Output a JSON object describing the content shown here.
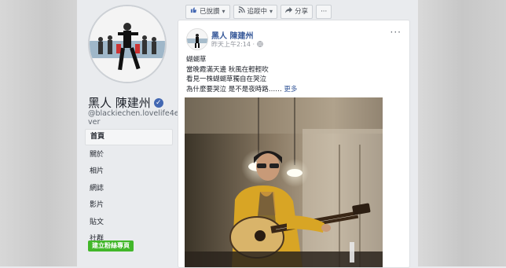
{
  "topbar": {
    "like_label": "已說讚",
    "follow_label": "追蹤中",
    "share_label": "分享",
    "more_label": "···"
  },
  "page": {
    "name": "黑人 陳建州",
    "handle": "@blackiechen.lovelife4ever"
  },
  "nav": {
    "items": [
      {
        "label": "首頁",
        "active": true
      },
      {
        "label": "關於"
      },
      {
        "label": "相片"
      },
      {
        "label": "網誌"
      },
      {
        "label": "影片"
      },
      {
        "label": "貼文"
      },
      {
        "label": "社群"
      }
    ],
    "create_button": "建立粉絲專頁"
  },
  "post": {
    "author": "黑人 陳建州",
    "time": "昨天上午2:14 · ",
    "menu": "···",
    "lines": [
      "蝴蝴草",
      "當晚霞滿天邊 秋風在輕輕吹",
      "看見一株蝴蝴草獨自在哭泣",
      "為什麼要哭泣 是不是夜時路……"
    ],
    "more_label": "更多"
  },
  "colors": {
    "link": "#365899",
    "verified": "#4267b2",
    "create_button": "#42b72a"
  },
  "icons": {
    "like": "thumbs-up-icon",
    "follow": "rss-icon",
    "share": "share-arrow-icon",
    "globe": "globe-icon",
    "verified": "verified-check-icon"
  }
}
